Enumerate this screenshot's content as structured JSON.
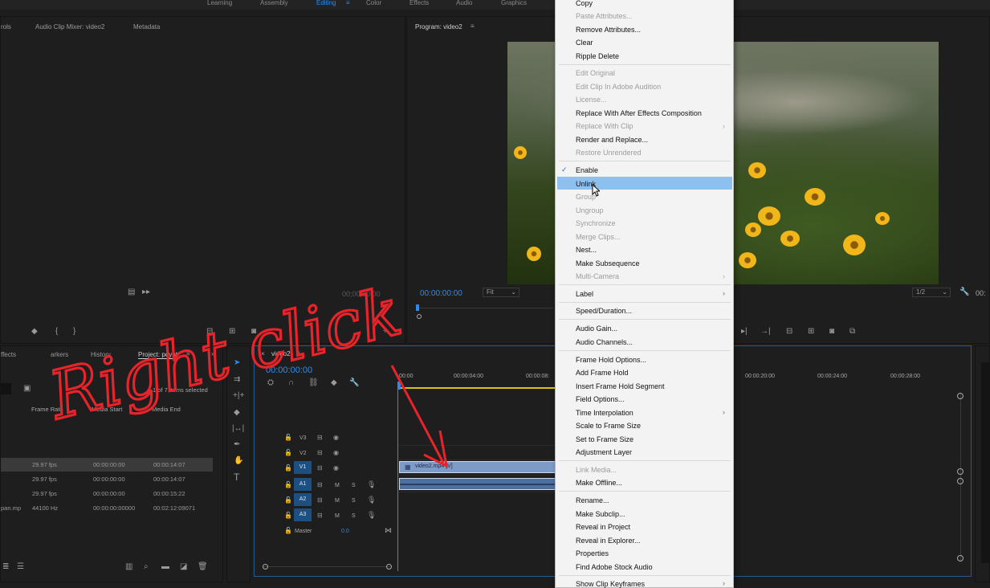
{
  "workspaces": [
    "Learning",
    "Assembly",
    "Editing",
    "Color",
    "Effects",
    "Audio",
    "Graphics"
  ],
  "source_panel": {
    "tabs": [
      "rols",
      "Audio Clip Mixer: video2",
      "Metadata"
    ],
    "timecode": "00;00;00;00"
  },
  "program_panel": {
    "title": "Program: video2",
    "timecode": "00:00:00:00",
    "fit": "Fit",
    "resolution": "1/2",
    "time_right": "00:"
  },
  "project_panel": {
    "tabs": [
      "ffects",
      "arkers",
      "History",
      "Project: poyot"
    ],
    "items_selected": "1 of 7 items selected",
    "columns": [
      "Frame Rate",
      "Media Start",
      "Media End"
    ],
    "rows": [
      {
        "name": "",
        "rate": "29.97 fps",
        "start": "00:00:00:00",
        "end": "00:00:14:07"
      },
      {
        "name": "",
        "rate": "29.97 fps",
        "start": "00:00:00:00",
        "end": "00:00:14:07"
      },
      {
        "name": "",
        "rate": "29.97 fps",
        "start": "00:00:00:00",
        "end": "00:00:15:22"
      },
      {
        "name": "pan.mp",
        "rate": "44100 Hz",
        "start": "00:00:00:00000",
        "end": "00:02:12:09071"
      }
    ]
  },
  "timeline": {
    "tab": "video2",
    "timecode": "00:00:00:00",
    "ruler": [
      "00:00",
      "00:00:04:00",
      "00:00:08:",
      "00:00:20:00",
      "00:00:24:00",
      "00:00:28:00"
    ],
    "tracks": {
      "v3": "V3",
      "v2": "V2",
      "v1": "V1",
      "a1": "A1",
      "a2": "A2",
      "a3": "A3",
      "master": "Master",
      "master_val": "0.0"
    },
    "clip_label": "video2.mp4 [V]",
    "m": "M",
    "s": "S"
  },
  "annotation": {
    "text": "Right click"
  },
  "context_menu": {
    "top": [
      "Copy",
      "Paste Attributes...",
      "Remove Attributes...",
      "Clear",
      "Ripple Delete"
    ],
    "edit": [
      "Edit Original",
      "Edit Clip In Adobe Audition",
      "License...",
      "Replace With After Effects Composition",
      "Replace With Clip",
      "Render and Replace...",
      "Restore Unrendered"
    ],
    "link": [
      "Enable",
      "Unlink",
      "Group",
      "Ungroup",
      "Synchronize",
      "Merge Clips...",
      "Nest...",
      "Make Subsequence",
      "Multi-Camera"
    ],
    "label": "Label",
    "speed": "Speed/Duration...",
    "audio": [
      "Audio Gain...",
      "Audio Channels..."
    ],
    "frame": [
      "Frame Hold Options...",
      "Add Frame Hold",
      "Insert Frame Hold Segment",
      "Field Options...",
      "Time Interpolation",
      "Scale to Frame Size",
      "Set to Frame Size",
      "Adjustment Layer"
    ],
    "media": [
      "Link Media...",
      "Make Offline..."
    ],
    "misc": [
      "Rename...",
      "Make Subclip...",
      "Reveal in Project",
      "Reveal in Explorer...",
      "Properties",
      "Find Adobe Stock Audio"
    ],
    "bottom": "Show Clip Keyframes"
  },
  "colors": {
    "accent": "#2d8ceb",
    "highlight": "#8ec0ef",
    "annotation": "#e8232a"
  }
}
